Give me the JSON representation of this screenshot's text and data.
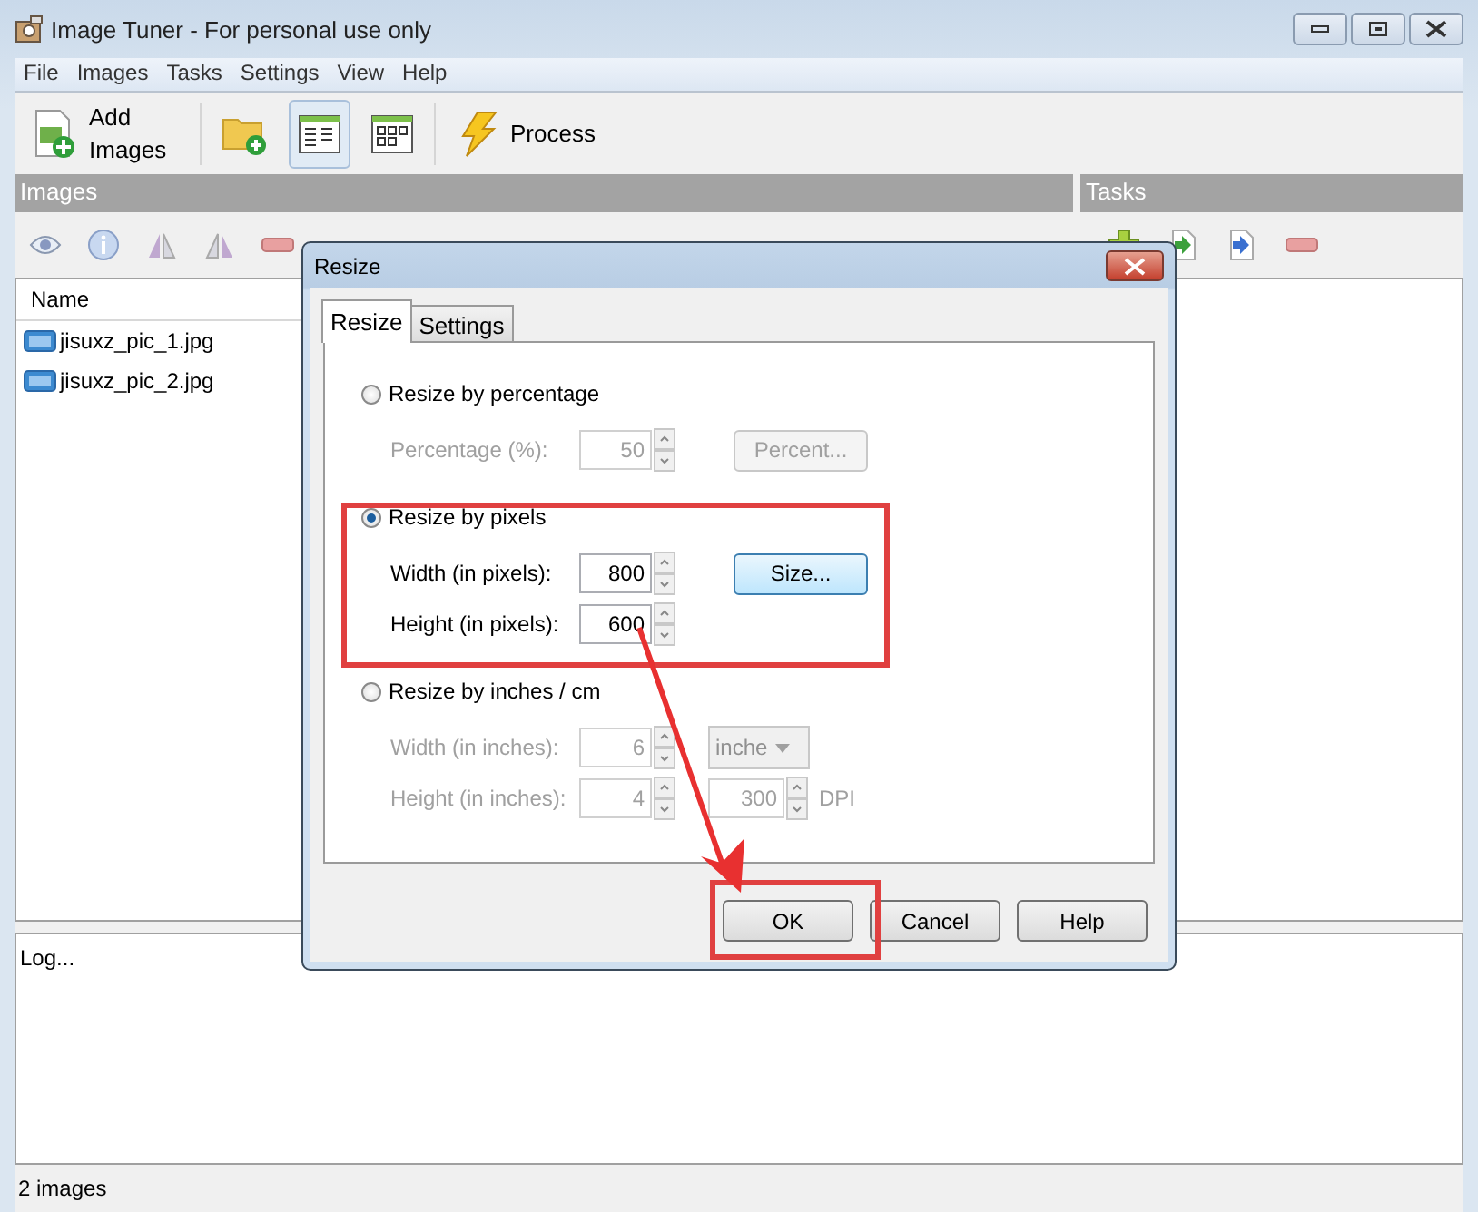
{
  "window": {
    "title": "Image Tuner - For personal use only"
  },
  "menu": [
    "File",
    "Images",
    "Tasks",
    "Settings",
    "View",
    "Help"
  ],
  "toolbar": [
    {
      "kind": "add",
      "label": "Add Images",
      "selected": false
    },
    {
      "kind": "folder",
      "selected": false
    },
    {
      "kind": "list",
      "selected": true
    },
    {
      "kind": "thumbs",
      "selected": false
    },
    {
      "kind": "process",
      "label": "Process",
      "selected": false
    }
  ],
  "images_panel": {
    "title": "Images",
    "column": "Name",
    "files": [
      "jisuxz_pic_1.jpg",
      "jisuxz_pic_2.jpg"
    ]
  },
  "tasks_panel": {
    "title": "Tasks"
  },
  "log": "Log...",
  "status_bar": "2 images",
  "dialog": {
    "title": "Resize",
    "tabs": [
      {
        "label": "Resize",
        "selected": true
      },
      {
        "label": "Settings",
        "selected": false
      }
    ],
    "groups": [
      {
        "label": "Resize by percentage",
        "selected": false,
        "rows": [
          {
            "label": "Percentage (%):",
            "value": "50",
            "side": {
              "kind": "button",
              "label": "Percent..."
            }
          }
        ]
      },
      {
        "label": "Resize by pixels",
        "selected": true,
        "rows": [
          {
            "label": "Width (in pixels):",
            "value": "800",
            "side": {
              "kind": "button",
              "label": "Size..."
            }
          },
          {
            "label": "Height (in pixels):",
            "value": "600"
          }
        ]
      },
      {
        "label": "Resize by inches / cm",
        "selected": false,
        "rows": [
          {
            "label": "Width (in inches):",
            "value": "6",
            "side": {
              "kind": "dropdown",
              "value": "inche"
            }
          },
          {
            "label": "Height (in inches):",
            "value": "4",
            "side": {
              "kind": "spin",
              "value": "300",
              "unit": "DPI"
            }
          }
        ]
      }
    ],
    "buttons": [
      "OK",
      "Cancel",
      "Help"
    ]
  }
}
